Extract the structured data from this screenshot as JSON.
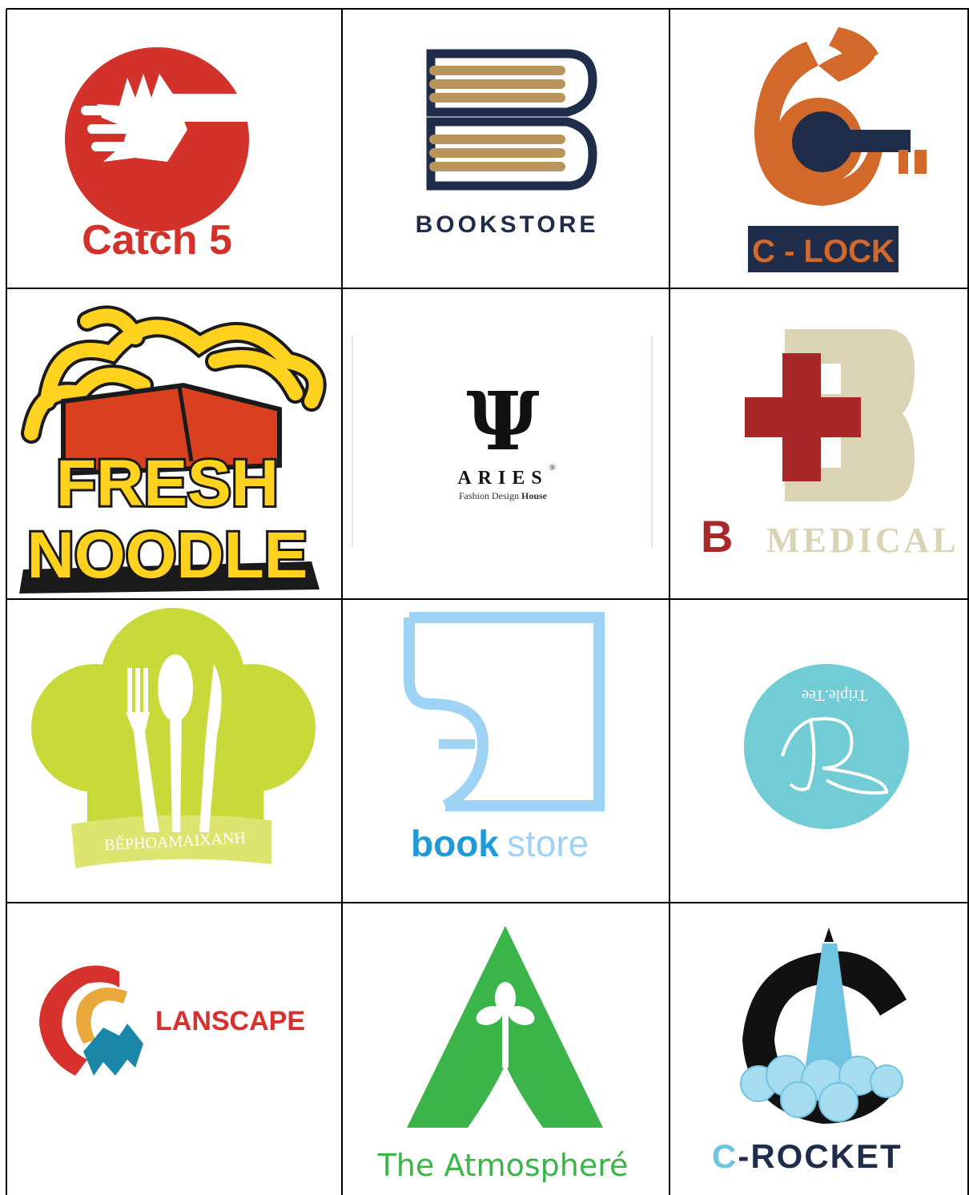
{
  "logos": {
    "catch5": {
      "label": "Catch 5",
      "color": "#d2322a"
    },
    "bookstore_dark": {
      "label": "BOOKSTORE",
      "navy": "#1f2d4a",
      "gold": "#b8955a"
    },
    "clock": {
      "label": "C - LOCK",
      "orange": "#d2692a",
      "navy": "#1f2d4a"
    },
    "fresh_noodle": {
      "line1": "FRESH",
      "line2": "NOODLE",
      "yellow": "#ffd21f",
      "red": "#d9401f"
    },
    "aries": {
      "mark": "Ψ",
      "name": "ARIES",
      "reg": "®",
      "tagline_a": "Fashion Design ",
      "tagline_b": "House"
    },
    "b_medical": {
      "letter": "B",
      "word": "MEDICAL",
      "red": "#a8282a",
      "beige": "#d8d4b4"
    },
    "bep": {
      "label": "BẾPHOAMAIXANH",
      "green": "#c8d93a"
    },
    "bookstore_light": {
      "part1": "book",
      "part2": "store",
      "blue": "#1e9ad8",
      "light": "#9fd3f5"
    },
    "triple_tee": {
      "label": "Triple.Tee",
      "color": "#72ccd6"
    },
    "lanscape": {
      "label": "LANSCAPE",
      "red": "#d7312e",
      "teal": "#1a86a8"
    },
    "atmosphere": {
      "label": "The Atmospheré",
      "green": "#3bb54a"
    },
    "crocket": {
      "label_c": "C",
      "label_rest": "-ROCKET",
      "blue": "#6fc4e0"
    }
  }
}
